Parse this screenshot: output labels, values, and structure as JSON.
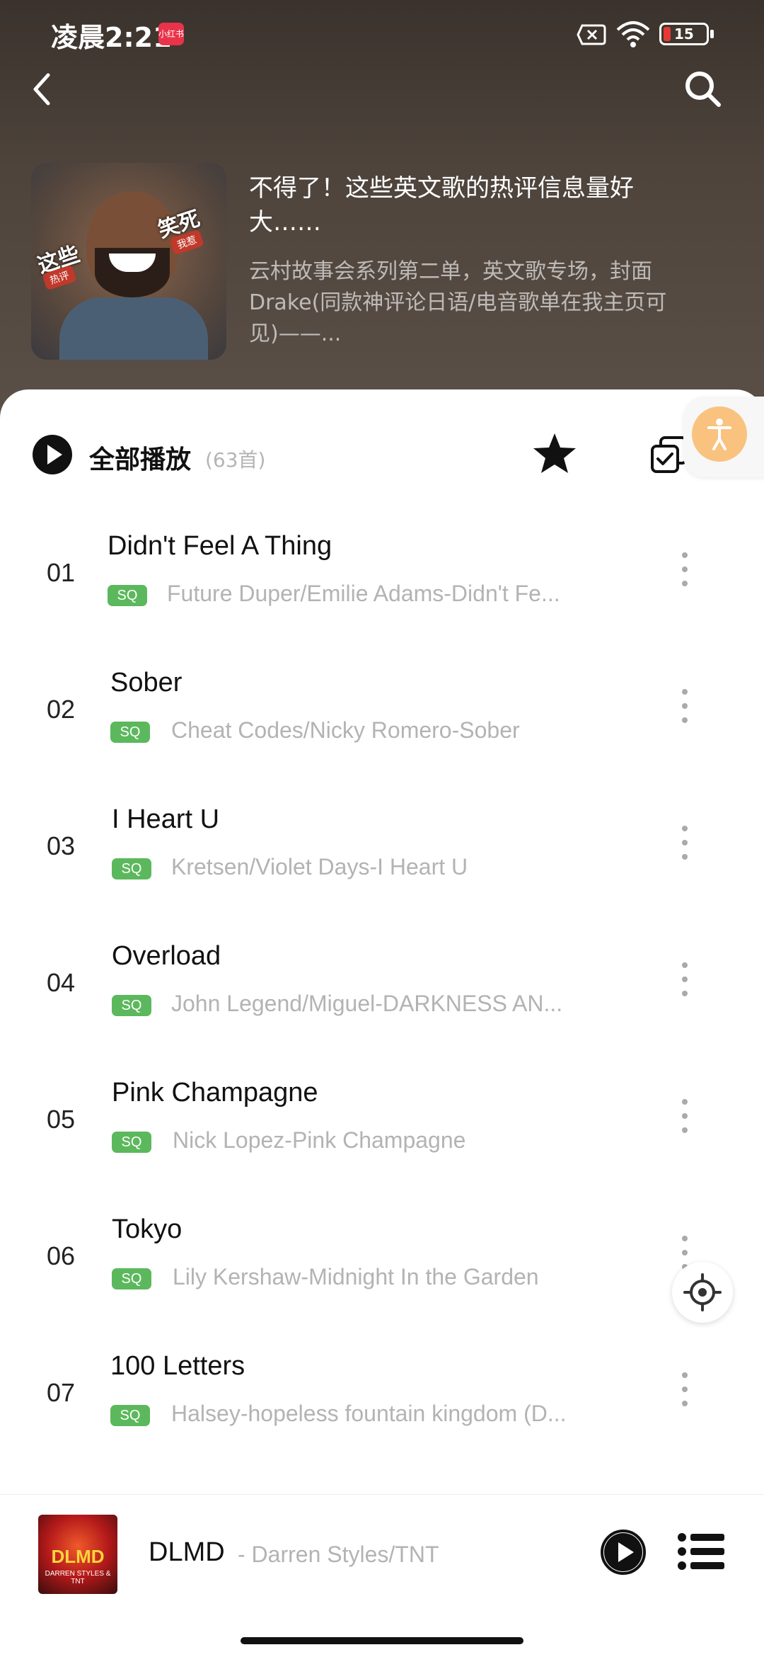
{
  "status_bar": {
    "time": "凌晨2:21",
    "app_badge": "小红书",
    "battery": "15"
  },
  "playlist": {
    "title": "不得了！这些英文歌的热评信息量好大……",
    "description": "云村故事会系列第二单，英文歌专场，封面Drake(同款神评论日语/电音歌单在我主页可见)——...",
    "cover_text_left": "这些",
    "cover_text_right": "笑死",
    "cover_tag_left": "热评",
    "cover_tag_right": "我惹"
  },
  "toolbar": {
    "play_all_label": "全部播放",
    "count": "(63首)"
  },
  "songs": [
    {
      "index": "01",
      "title": "Didn't Feel A Thing",
      "quality": "SQ",
      "artist": "Future Duper/Emilie Adams-Didn't Fe..."
    },
    {
      "index": "02",
      "title": "Sober",
      "quality": "SQ",
      "artist": "Cheat Codes/Nicky Romero-Sober"
    },
    {
      "index": "03",
      "title": "I Heart U",
      "quality": "SQ",
      "artist": "Kretsen/Violet Days-I Heart U"
    },
    {
      "index": "04",
      "title": "Overload",
      "quality": "SQ",
      "artist": "John Legend/Miguel-DARKNESS AN..."
    },
    {
      "index": "05",
      "title": "Pink Champagne",
      "quality": "SQ",
      "artist": "Nick Lopez-Pink Champagne"
    },
    {
      "index": "06",
      "title": "Tokyo",
      "quality": "SQ",
      "artist": "Lily Kershaw-Midnight In the Garden"
    },
    {
      "index": "07",
      "title": "100 Letters",
      "quality": "SQ",
      "artist": "Halsey-hopeless fountain kingdom (D..."
    }
  ],
  "mini_player": {
    "title": "DLMD",
    "artist": "- Darren Styles/TNT",
    "cover_text": "DLMD",
    "cover_sub": "DARREN STYLES & TNT"
  },
  "colors": {
    "header_bg": "#4e443c",
    "sq_badge": "#5cb85c",
    "accessibility": "#f9c27f"
  },
  "icons": [
    "back-icon",
    "search-icon",
    "play-circle-icon",
    "star-icon",
    "multi-select-icon",
    "more-vertical-icon",
    "locate-icon",
    "playlist-icon",
    "accessibility-icon"
  ]
}
